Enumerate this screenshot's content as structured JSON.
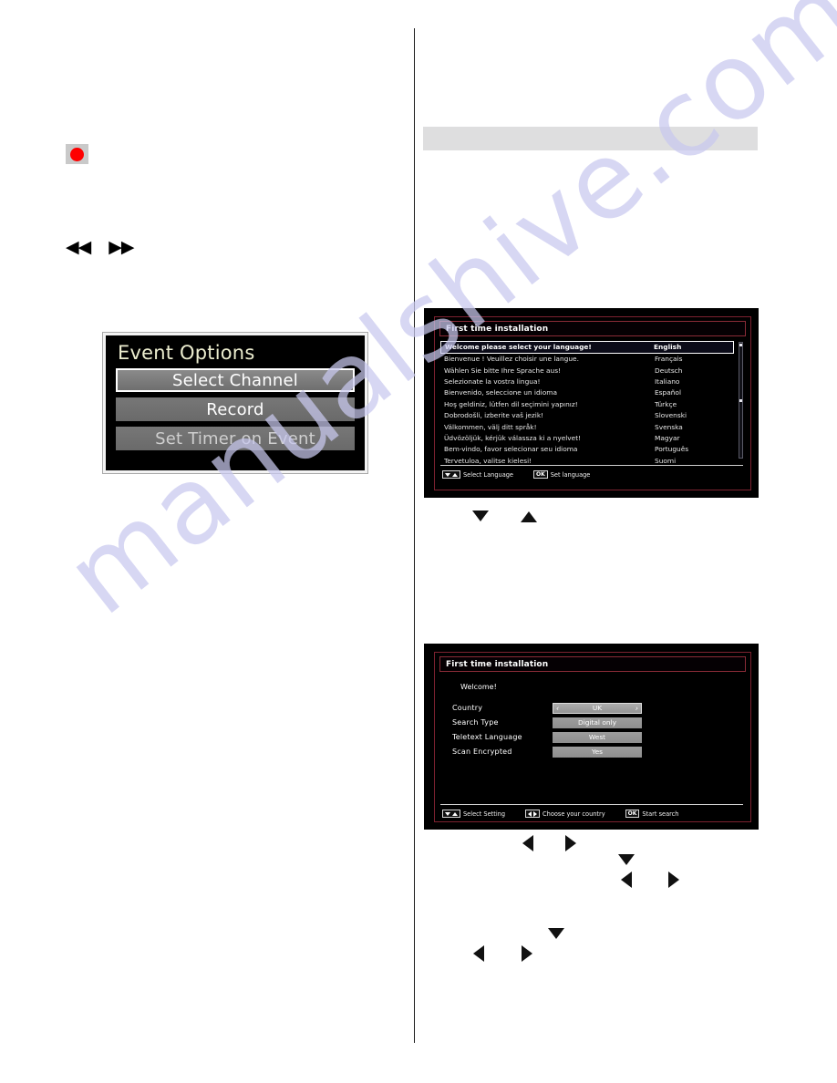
{
  "page": {
    "watermark": "manualshive.com",
    "background": "#ffffff",
    "accent_red": "#fe0000",
    "osd_title_color": "#ecedcf",
    "osd_frame_red": "#7d2230"
  },
  "left_column": {
    "record_key": {
      "icon": "record-circle-icon",
      "color": "#fe0000"
    },
    "transport_keys": [
      {
        "icon": "rewind-icon",
        "glyph": "◀◀"
      },
      {
        "icon": "fast-forward-icon",
        "glyph": "▶▶"
      }
    ],
    "event_options": {
      "title": "Event Options",
      "items": [
        {
          "label": "Select Channel",
          "selected": true
        },
        {
          "label": "Record",
          "selected": false
        },
        {
          "label": "Set Timer on Event",
          "selected": false
        }
      ]
    }
  },
  "right_column": {
    "gray_band": {
      "text": ""
    },
    "language_screen": {
      "header": "First time installation",
      "rows": [
        {
          "prompt": "Welcome please select your language!",
          "name": "English",
          "selected": true
        },
        {
          "prompt": "Bienvenue ! Veuillez choisir une langue.",
          "name": "Français",
          "selected": false
        },
        {
          "prompt": "Wählen Sie bitte Ihre Sprache aus!",
          "name": "Deutsch",
          "selected": false
        },
        {
          "prompt": "Selezionate la vostra lingua!",
          "name": "Italiano",
          "selected": false
        },
        {
          "prompt": "Bienvenido, seleccione un idioma",
          "name": "Español",
          "selected": false
        },
        {
          "prompt": "Hoş geldiniz, lütfen dil seçimini yapınız!",
          "name": "Türkçe",
          "selected": false
        },
        {
          "prompt": "Dobrodošli, izberite vaš jezik!",
          "name": "Slovenski",
          "selected": false
        },
        {
          "prompt": "Välkommen, välj ditt språk!",
          "name": "Svenska",
          "selected": false
        },
        {
          "prompt": "Üdvözöljük, kérjük válassza ki a nyelvet!",
          "name": "Magyar",
          "selected": false
        },
        {
          "prompt": "Bem-vindo, favor selecionar seu idioma",
          "name": "Português",
          "selected": false
        },
        {
          "prompt": "Tervetuloa, valitse kielesi!",
          "name": "Suomi",
          "selected": false
        }
      ],
      "footer": [
        {
          "keys": [
            "down",
            "up"
          ],
          "label": "Select Language"
        },
        {
          "keys": [
            "OK"
          ],
          "label": "Set language"
        }
      ]
    },
    "settings_screen": {
      "header": "First time installation",
      "welcome": "Welcome!",
      "settings": [
        {
          "label": "Country",
          "value": "UK",
          "active": true
        },
        {
          "label": "Search Type",
          "value": "Digital only",
          "active": false
        },
        {
          "label": "Teletext Language",
          "value": "West",
          "active": false
        },
        {
          "label": "Scan Encrypted",
          "value": "Yes",
          "active": false
        }
      ],
      "footer": [
        {
          "keys": [
            "down",
            "up"
          ],
          "label": "Select Setting"
        },
        {
          "keys": [
            "left",
            "right"
          ],
          "label": "Choose your country"
        },
        {
          "keys": [
            "OK"
          ],
          "label": "Start search"
        }
      ]
    },
    "inline_arrows": {
      "after_language_screen": [
        "down",
        "up"
      ],
      "after_settings_screen_row1": [
        "left",
        "right"
      ],
      "after_settings_screen_row2": [
        "down"
      ],
      "after_settings_screen_row3": [
        "left",
        "right"
      ],
      "bottom_row": [
        "left",
        "right"
      ],
      "bottom_row_extra": [
        "down"
      ]
    }
  }
}
